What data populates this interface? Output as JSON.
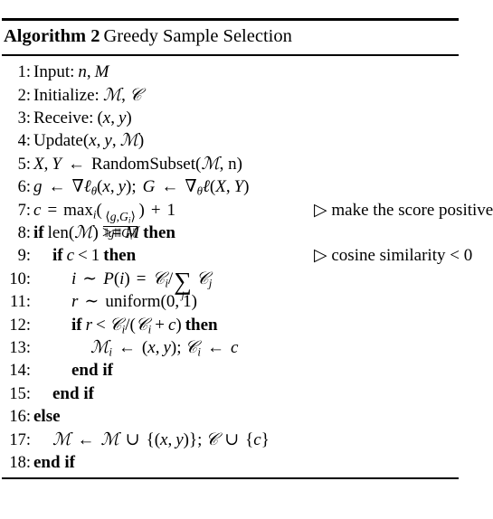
{
  "title": {
    "keyword": "Algorithm 2",
    "name": "Greedy Sample Selection"
  },
  "lines": [
    {
      "no": "1:",
      "indent": 0,
      "text": "Input: n, M"
    },
    {
      "no": "2:",
      "indent": 0,
      "text": "Initialize: ℳ, 𝒞"
    },
    {
      "no": "3:",
      "indent": 0,
      "text": "Receive: (x, y)"
    },
    {
      "no": "4:",
      "indent": 0,
      "text": "Update(x, y, ℳ)"
    },
    {
      "no": "5:",
      "indent": 0,
      "text": "X, Y ← RandomSubset(ℳ, n)"
    },
    {
      "no": "6:",
      "indent": 0,
      "text": "g ← ∇ℓθ(x, y); G ← ∇θℓ(X, Y)"
    },
    {
      "no": "7:",
      "indent": 0,
      "text": "c = max i ( ⟨g,G i⟩ / ‖g‖‖G i‖ ) + 1",
      "comment": "▷ make the score positive"
    },
    {
      "no": "8:",
      "indent": 0,
      "text": "if len(ℳ) >= M then"
    },
    {
      "no": "9:",
      "indent": 1,
      "text": "if c < 1 then",
      "comment": "▷ cosine similarity < 0"
    },
    {
      "no": "10:",
      "indent": 2,
      "text": "i ∼ P(i) = 𝒞 i / ∑ j 𝒞 j"
    },
    {
      "no": "11:",
      "indent": 2,
      "text": "r ∼ uniform(0, 1)"
    },
    {
      "no": "12:",
      "indent": 2,
      "text": "if r < 𝒞 i/(𝒞 i + c) then"
    },
    {
      "no": "13:",
      "indent": 3,
      "text": "ℳ i ← (x, y); 𝒞 i ← c"
    },
    {
      "no": "14:",
      "indent": 2,
      "text": "end if"
    },
    {
      "no": "15:",
      "indent": 1,
      "text": "end if"
    },
    {
      "no": "16:",
      "indent": 0,
      "text": "else"
    },
    {
      "no": "17:",
      "indent": 1,
      "text": "ℳ ← ℳ ∪ {(x, y)}; 𝒞 ∪ {c}"
    },
    {
      "no": "18:",
      "indent": 0,
      "text": "end if"
    }
  ],
  "symbols": {
    "arrow_left": "←",
    "nabla": "∇",
    "theta": "θ",
    "ell": "ℓ",
    "sim": "∼",
    "cup": "∪",
    "sum": "∑",
    "triangle_marker": "▷",
    "angle_open": "⟨",
    "angle_close": "⟩",
    "norm_bar": "‖",
    "script_m": "ℳ",
    "script_c": "𝒞"
  },
  "comments": {
    "line7": "▷ make the score positive",
    "line9": "▷ cosine similarity < 0"
  },
  "colors": {
    "text": "#000000",
    "background": "#ffffff",
    "rule": "#000000"
  }
}
